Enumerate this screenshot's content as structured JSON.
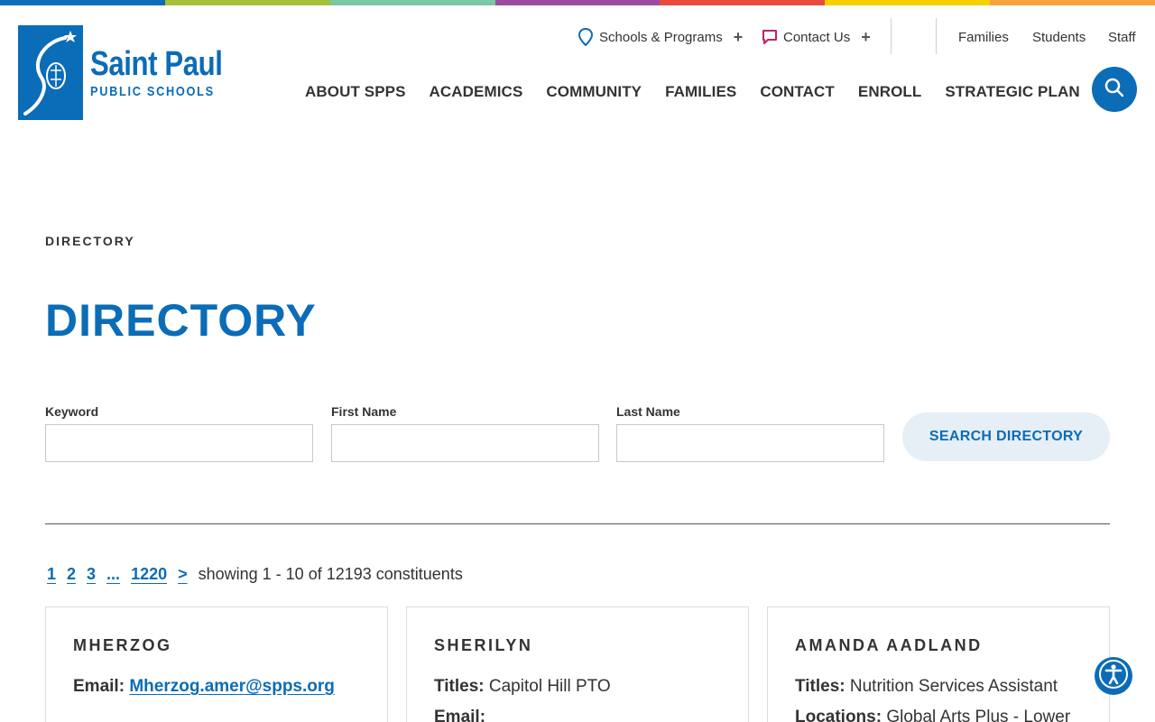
{
  "color_bar": [
    "#0b6cb7",
    "#a5c23b",
    "#7bc8a4",
    "#9b4c9f",
    "#e94a3f",
    "#f5d000",
    "#f7a23b"
  ],
  "brand": {
    "primary": "#0b6cb7"
  },
  "logo": {
    "title": "Saint Paul",
    "subtitle": "PUBLIC SCHOOLS"
  },
  "utility": {
    "schools_programs": "Schools & Programs",
    "contact_us": "Contact Us",
    "families": "Families",
    "students": "Students",
    "staff": "Staff"
  },
  "nav": [
    "ABOUT SPPS",
    "ACADEMICS",
    "COMMUNITY",
    "FAMILIES",
    "CONTACT",
    "ENROLL",
    "STRATEGIC PLAN"
  ],
  "breadcrumb": "DIRECTORY",
  "page_title": "DIRECTORY",
  "form": {
    "keyword_label": "Keyword",
    "first_name_label": "First Name",
    "last_name_label": "Last Name",
    "keyword_value": "",
    "first_name_value": "",
    "last_name_value": "",
    "search_button": "SEARCH DIRECTORY"
  },
  "pager": {
    "pages": [
      "1",
      "2",
      "3",
      "...",
      "1220"
    ],
    "next": ">",
    "info": "showing 1 - 10 of 12193 constituents"
  },
  "cards": [
    {
      "name": "MHERZOG",
      "line1_label": "Email:",
      "line1_value": "Mherzog.amer@spps.org",
      "line2": ""
    },
    {
      "name": "SHERILYN",
      "line1_label": "Titles:",
      "line1_value": "Capitol Hill PTO",
      "line2": "Email:"
    },
    {
      "name": "AMANDA AADLAND",
      "line1_label": "Titles:",
      "line1_value": "Nutrition Services Assistant",
      "line2_label": "Locations:",
      "line2_value": "Global Arts Plus - Lower"
    }
  ]
}
